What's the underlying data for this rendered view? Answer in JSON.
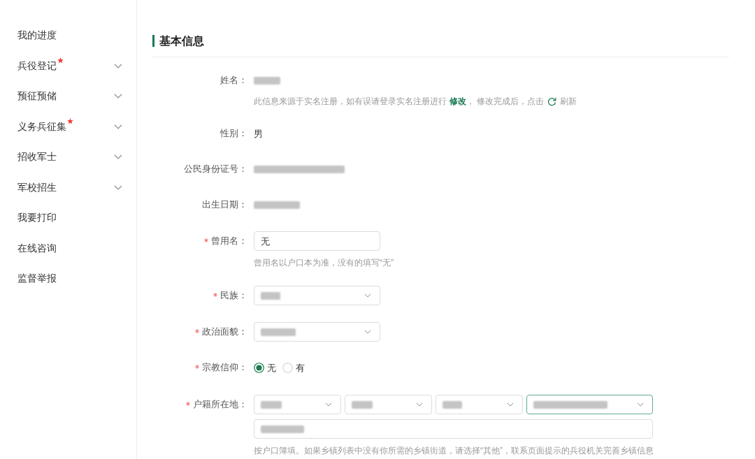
{
  "sidebar": {
    "items": [
      {
        "label": "我的进度",
        "kind": "link"
      },
      {
        "label": "兵役登记",
        "kind": "group",
        "required": true,
        "expanded": false
      },
      {
        "label": "预征预储",
        "kind": "group",
        "required": false,
        "expanded": false
      },
      {
        "label": "义务兵征集",
        "kind": "group",
        "required": true,
        "expanded": false
      },
      {
        "label": "招收军士",
        "kind": "group",
        "required": false,
        "expanded": false
      },
      {
        "label": "军校招生",
        "kind": "group",
        "required": false,
        "expanded": false
      },
      {
        "label": "我要打印",
        "kind": "link"
      },
      {
        "label": "在线咨询",
        "kind": "link"
      },
      {
        "label": "监督举报",
        "kind": "link"
      }
    ]
  },
  "section": {
    "title": "基本信息"
  },
  "fields": [
    {
      "kind": "readonly",
      "label": "姓名：",
      "required": false,
      "redacted": true,
      "note": {
        "before": "此信息来源于实名注册，如有误请登录实名注册进行",
        "link": "修改",
        "middle": "， 修改完成后，点击",
        "after": "刷新"
      }
    },
    {
      "kind": "readonly",
      "label": "性别：",
      "required": false,
      "redacted": false,
      "value": "男"
    },
    {
      "kind": "readonly",
      "label": "公民身份证号：",
      "required": false,
      "redacted": true
    },
    {
      "kind": "readonly",
      "label": "出生日期：",
      "required": false,
      "redacted": true
    },
    {
      "kind": "text",
      "label": "曾用名：",
      "required": true,
      "redacted": false,
      "value": "无",
      "help": "曾用名以户口本为准，没有的填写“无”"
    },
    {
      "kind": "select",
      "label": "民族：",
      "required": true,
      "redacted": true
    },
    {
      "kind": "select",
      "label": "政治面貌：",
      "required": true,
      "redacted": true
    },
    {
      "kind": "radio",
      "label": "宗教信仰：",
      "required": true,
      "options": [
        {
          "label": "无",
          "selected": true
        },
        {
          "label": "有",
          "selected": false
        }
      ]
    },
    {
      "kind": "address",
      "label": "户籍所在地：",
      "required": true,
      "selects": [
        {
          "redacted": true,
          "focused": false
        },
        {
          "redacted": true,
          "focused": false
        },
        {
          "redacted": true,
          "focused": false
        },
        {
          "redacted": true,
          "focused": true
        }
      ],
      "detail": {
        "redacted": true
      },
      "help": "按户口簿填。如果乡镇列表中没有你所需的乡镇街道，请选择“其他”，联系页面提示的兵役机关完善乡镇信息"
    }
  ]
}
